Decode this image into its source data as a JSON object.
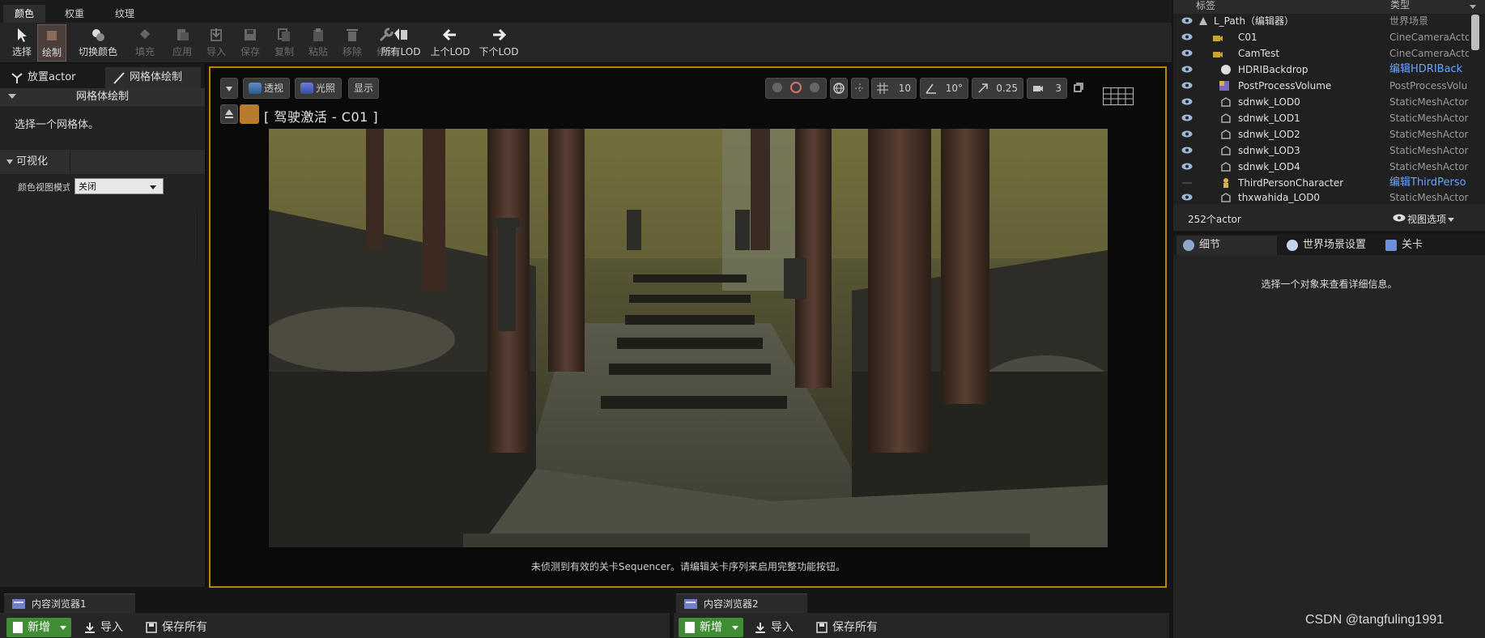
{
  "mode_tabs": [
    "颜色",
    "权重",
    "纹理"
  ],
  "toolbar": {
    "select": "选择",
    "paint": "绘制",
    "swap_color": "切换颜色",
    "fill": "填充",
    "apply": "应用",
    "import": "导入",
    "save": "保存",
    "copy": "复制",
    "paste": "粘贴",
    "remove": "移除",
    "fix": "修复",
    "all_lod": "所有LOD",
    "prev_lod": "上个LOD",
    "next_lod": "下个LOD"
  },
  "left_panel": {
    "tab_place": "放置actor",
    "tab_mesh_paint": "网格体绘制",
    "section_header": "网格体绘制",
    "hint": "选择一个网格体。",
    "visualization": "可视化",
    "color_view_label": "颜色视图模式",
    "color_view_value": "关闭"
  },
  "viewport": {
    "perspective": "透视",
    "lit": "光照",
    "show": "显示",
    "grid_snap": "10",
    "rotation_snap": "10°",
    "scale_snap": "0.25",
    "camera_speed": "3",
    "pilot_label": "[ 驾驶激活 - C01 ]",
    "sequencer_message": "未侦测到有效的关卡Sequencer。请编辑关卡序列来启用完整功能按钮。"
  },
  "outliner": {
    "col_label": "标签",
    "col_type": "类型",
    "rows": [
      {
        "name": "L_Path（编辑器）",
        "type": "世界场景",
        "link": false
      },
      {
        "name": "C01",
        "type": "CineCameraActo",
        "link": false
      },
      {
        "name": "CamTest",
        "type": "CineCameraActo",
        "link": false
      },
      {
        "name": "HDRIBackdrop",
        "type": "编辑HDRIBack",
        "link": true
      },
      {
        "name": "PostProcessVolume",
        "type": "PostProcessVolu",
        "link": false
      },
      {
        "name": "sdnwk_LOD0",
        "type": "StaticMeshActor",
        "link": false
      },
      {
        "name": "sdnwk_LOD1",
        "type": "StaticMeshActor",
        "link": false
      },
      {
        "name": "sdnwk_LOD2",
        "type": "StaticMeshActor",
        "link": false
      },
      {
        "name": "sdnwk_LOD3",
        "type": "StaticMeshActor",
        "link": false
      },
      {
        "name": "sdnwk_LOD4",
        "type": "StaticMeshActor",
        "link": false
      },
      {
        "name": "ThirdPersonCharacter",
        "type": "编辑ThirdPerso",
        "link": true
      },
      {
        "name": "thxwahida_LOD0",
        "type": "StaticMeshActor",
        "link": false
      }
    ],
    "count": "252个actor",
    "view_options": "视图选项"
  },
  "details": {
    "tab_details": "细节",
    "tab_world_settings": "世界场景设置",
    "tab_level": "关卡",
    "hint": "选择一个对象来查看详细信息。"
  },
  "content_browsers": [
    {
      "title": "内容浏览器1",
      "new": "新增",
      "import": "导入",
      "save_all": "保存所有"
    },
    {
      "title": "内容浏览器2",
      "new": "新增",
      "import": "导入",
      "save_all": "保存所有"
    }
  ],
  "watermark": "CSDN @tangfuling1991",
  "colors": {
    "viewport_border": "#b8860b",
    "new_button": "#3f8e34",
    "link": "#6aa4ff"
  }
}
